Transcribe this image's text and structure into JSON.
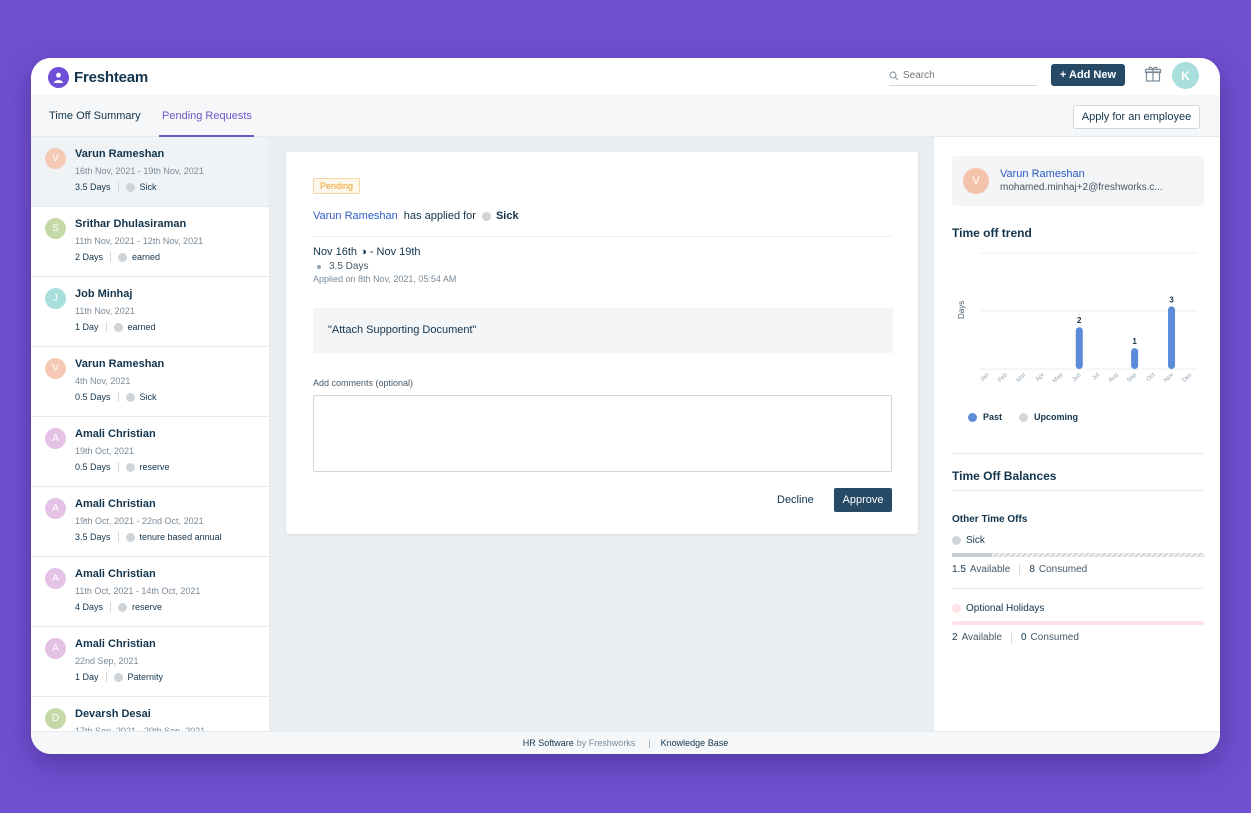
{
  "brand": {
    "name": "Freshteam",
    "color": "#6f4fd6"
  },
  "header": {
    "search_placeholder": "Search",
    "add_new_label": "+ Add New",
    "gift_icon": "gift-icon",
    "user_initial": "K"
  },
  "tabs": {
    "summary": "Time Off Summary",
    "pending": "Pending Requests",
    "apply_for_employee": "Apply for an employee"
  },
  "requests": [
    {
      "initial": "V",
      "color": "#f5c9b5",
      "name": "Varun Rameshan",
      "dates": "16th Nov, 2021 - 19th Nov, 2021",
      "days": "3.5 Days",
      "type": "Sick"
    },
    {
      "initial": "S",
      "color": "#c5d9a8",
      "name": "Srithar Dhulasiraman",
      "dates": "11th Nov, 2021 - 12th Nov, 2021",
      "days": "2 Days",
      "type": "earned"
    },
    {
      "initial": "J",
      "color": "#a8dedc",
      "name": "Job Minhaj",
      "dates": "11th Nov, 2021",
      "days": "1 Day",
      "type": "earned"
    },
    {
      "initial": "V",
      "color": "#f5c9b5",
      "name": "Varun Rameshan",
      "dates": "4th Nov, 2021",
      "days": "0.5 Days",
      "type": "Sick"
    },
    {
      "initial": "A",
      "color": "#e3c2e6",
      "name": "Amali Christian",
      "dates": "19th Oct, 2021",
      "days": "0.5 Days",
      "type": "reserve"
    },
    {
      "initial": "A",
      "color": "#e3c2e6",
      "name": "Amali Christian",
      "dates": "19th Oct, 2021 - 22nd Oct, 2021",
      "days": "3.5 Days",
      "type": "tenure based annual"
    },
    {
      "initial": "A",
      "color": "#e3c2e6",
      "name": "Amali Christian",
      "dates": "11th Oct, 2021 - 14th Oct, 2021",
      "days": "4 Days",
      "type": "reserve"
    },
    {
      "initial": "A",
      "color": "#e3c2e6",
      "name": "Amali Christian",
      "dates": "22nd Sep, 2021",
      "days": "1 Day",
      "type": "Paternity"
    },
    {
      "initial": "D",
      "color": "#c5d9a8",
      "name": "Devarsh Desai",
      "dates": "17th Sep, 2021 - 20th Sep, 2021",
      "days": "",
      "type": ""
    }
  ],
  "detail": {
    "status": "Pending",
    "employee": "Varun Rameshan",
    "applied_for_text": "has applied for",
    "leave_type": "Sick",
    "range": "Nov 16th ◑ - Nov 19th",
    "days": "3.5 Days",
    "applied_on": "Applied on 8th Nov, 2021, 05:54 AM",
    "document_note": "\"Attach Supporting Document\"",
    "comments_label": "Add comments (optional)",
    "comments_value": "",
    "decline_label": "Decline",
    "approve_label": "Approve"
  },
  "side": {
    "employee_initial": "V",
    "employee_name": "Varun Rameshan",
    "employee_email": "mohamed.minhaj+2@freshworks.c...",
    "trend_title": "Time off trend",
    "balances_title": "Time Off Balances",
    "other_title": "Other Time Offs",
    "balances": [
      {
        "name": "Sick",
        "available": "1.5",
        "available_label": "Available",
        "consumed": "8",
        "consumed_label": "Consumed",
        "dot_color": "#cfd4d8"
      },
      {
        "name": "Optional Holidays",
        "available": "2",
        "available_label": "Available",
        "consumed": "0",
        "consumed_label": "Consumed",
        "dot_color": "#fde3e6"
      }
    ]
  },
  "chart_data": {
    "type": "bar",
    "ylabel": "Days",
    "categories": [
      "Jan",
      "Feb",
      "Mar",
      "Apr",
      "May",
      "Jun",
      "Jul",
      "Aug",
      "Sep",
      "Oct",
      "Nov",
      "Dec"
    ],
    "series": [
      {
        "name": "Past",
        "color": "#5b8ad8",
        "values": [
          0,
          0,
          0,
          0,
          0,
          2,
          0,
          0,
          1,
          0,
          3,
          0
        ]
      },
      {
        "name": "Upcoming",
        "color": "#d3d7db",
        "values": [
          0,
          0,
          0,
          0,
          0,
          0,
          0,
          0,
          0,
          0,
          0,
          0
        ]
      }
    ],
    "grid": true
  },
  "footer": {
    "hr_software": "HR Software",
    "by": "by Freshworks",
    "pipe": "|",
    "knowledge_base": "Knowledge Base"
  }
}
